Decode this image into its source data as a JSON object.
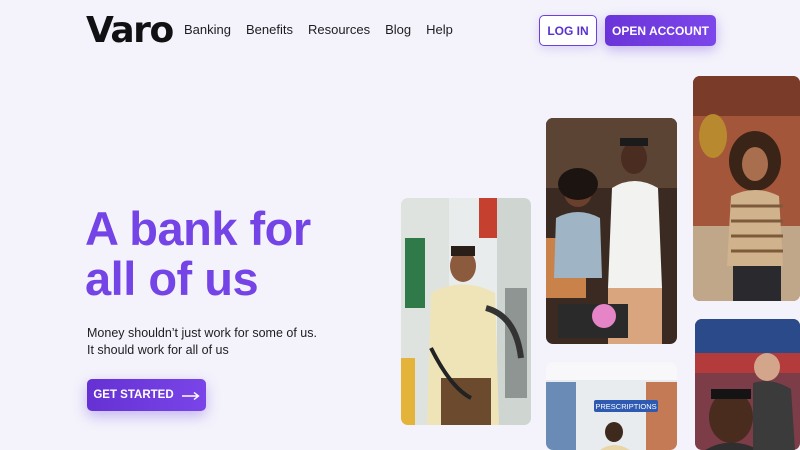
{
  "header": {
    "logo": "Varo",
    "nav": [
      "Banking",
      "Benefits",
      "Resources",
      "Blog",
      "Help"
    ],
    "login_label": "LOG IN",
    "open_account_label": "OPEN ACCOUNT"
  },
  "hero": {
    "title_line1": "A bank for",
    "title_line2": "all of us",
    "subtitle_line1": "Money shouldn’t just work for some of us.",
    "subtitle_line2": "It should work for all of us",
    "cta_label": "GET STARTED"
  },
  "photos": {
    "grocery_sign": "PRESCRIPTIONS"
  },
  "colors": {
    "accent": "#7444e6",
    "button": "#6a34d8",
    "background": "#f4f3fb"
  }
}
